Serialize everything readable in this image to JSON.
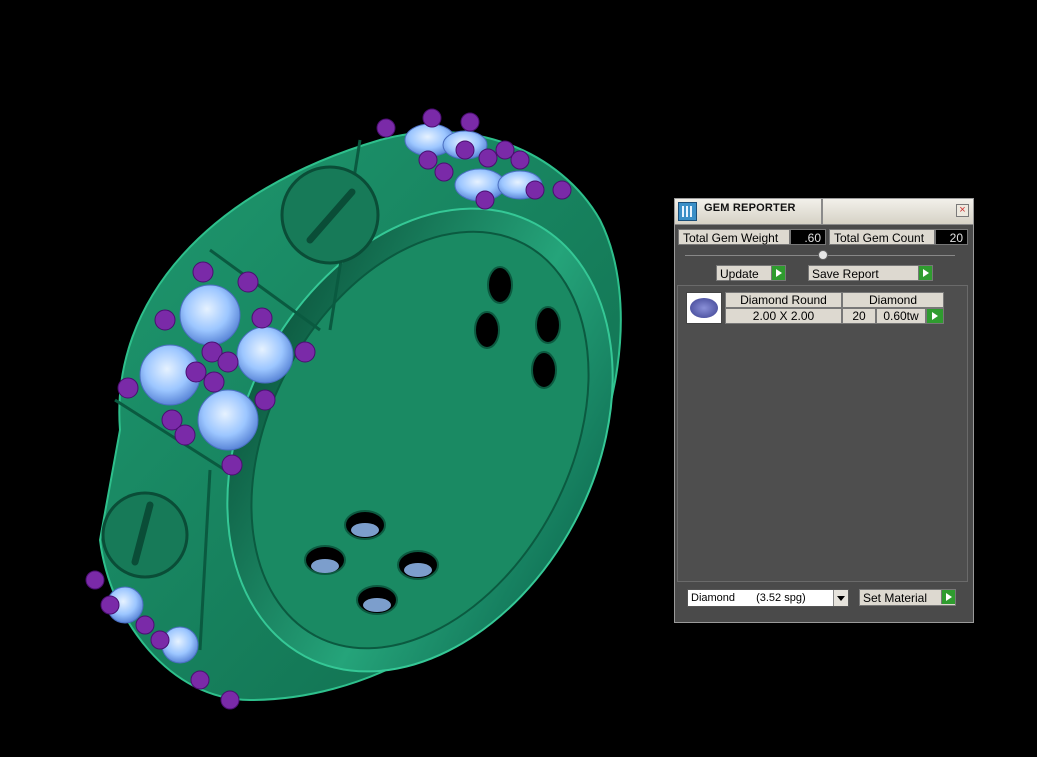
{
  "viewport": {
    "background": "#000000",
    "ring_color": "#1e8c66",
    "gem_color": "#9cc6ff",
    "prong_color": "#7a2aa8"
  },
  "panel": {
    "title": "GEM REPORTER",
    "close_icon": "close-icon",
    "total_gem_weight_label": "Total Gem Weight",
    "total_gem_weight_value": ".60",
    "total_gem_count_label": "Total Gem Count",
    "total_gem_count_value": "20",
    "update_label": "Update",
    "save_report_label": "Save Report",
    "gem_row": {
      "shape": "Diamond Round",
      "material": "Diamond",
      "size": "2.00 X 2.00",
      "count": "20",
      "weight": "0.60tw"
    },
    "material_select": {
      "selected": "Diamond",
      "density": "(3.52 spg)"
    },
    "set_material_label": "Set Material"
  }
}
